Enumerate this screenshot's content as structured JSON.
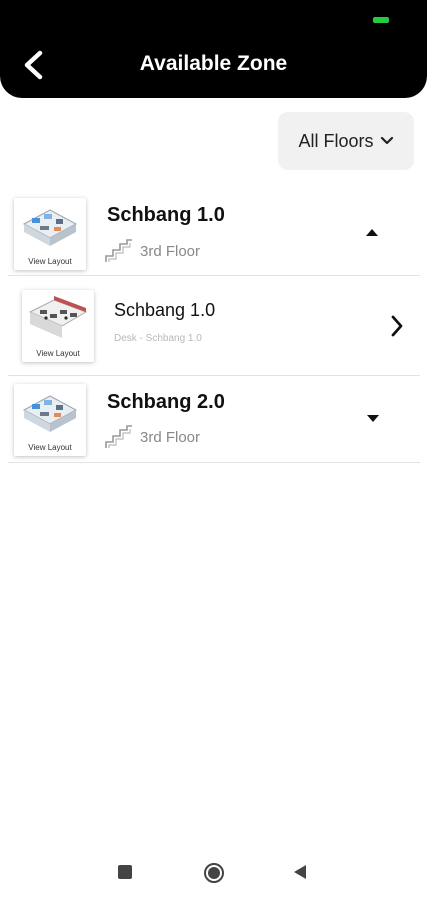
{
  "header": {
    "title": "Available Zone"
  },
  "filter": {
    "label": "All Floors"
  },
  "zones": [
    {
      "name": "Schbang 1.0",
      "floor": "3rd Floor",
      "thumb_label": "View Layout",
      "expanded": true
    },
    {
      "name": "Schbang 2.0",
      "floor": "3rd Floor",
      "thumb_label": "View Layout",
      "expanded": false
    }
  ],
  "subzone": {
    "name": "Schbang 1.0",
    "desc": "Desk - Schbang 1.0",
    "thumb_label": "View Layout"
  },
  "colors": {
    "header_bg": "#000000",
    "battery": "#27c93f",
    "filter_bg": "#f1f1f1"
  },
  "icons": [
    "back-arrow-icon",
    "chevron-down-icon",
    "stairs-icon",
    "caret-up-icon",
    "caret-down-icon",
    "chevron-right-icon",
    "square-nav-icon",
    "circle-nav-icon",
    "triangle-back-nav-icon"
  ]
}
